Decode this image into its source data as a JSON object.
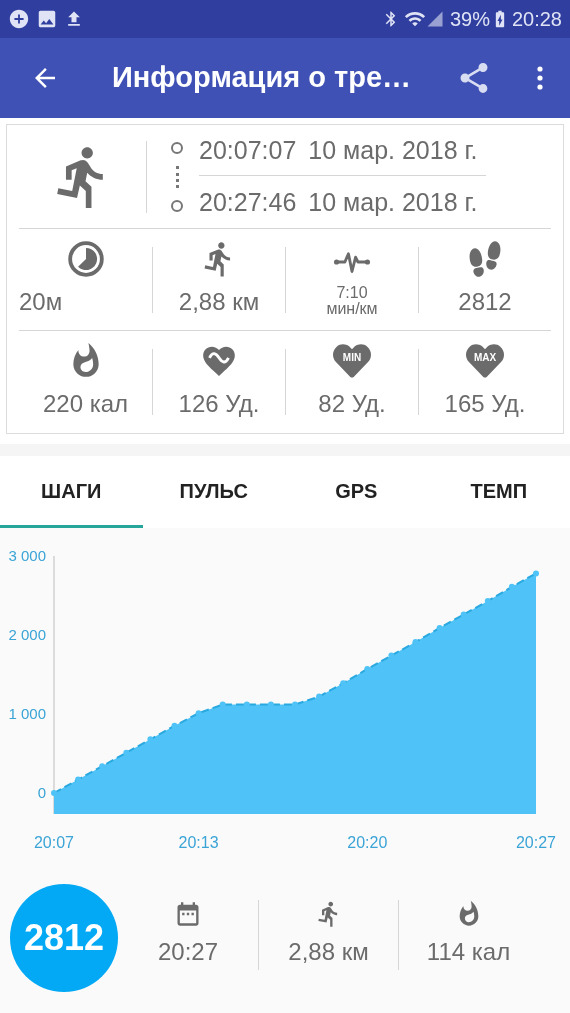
{
  "status_bar": {
    "battery": "39%",
    "time": "20:28"
  },
  "app_bar": {
    "title": "Информация о тре…"
  },
  "summary": {
    "start": {
      "time": "20:07:07",
      "date": "10 мар. 2018 г."
    },
    "end": {
      "time": "20:27:46",
      "date": "10 мар. 2018 г."
    },
    "rows": [
      [
        {
          "lines": [
            "20м"
          ]
        },
        {
          "lines": [
            "2,88 км"
          ]
        },
        {
          "lines": [
            "7:10",
            "мин/км"
          ]
        },
        {
          "lines": [
            "2812"
          ]
        }
      ],
      [
        {
          "lines": [
            "220 кал"
          ]
        },
        {
          "lines": [
            "126 Уд."
          ]
        },
        {
          "badge": "MIN",
          "lines": [
            "82 Уд."
          ]
        },
        {
          "badge": "MAX",
          "lines": [
            "165 Уд."
          ]
        }
      ]
    ]
  },
  "tabs": [
    {
      "label": "ШАГИ",
      "selected": true
    },
    {
      "label": "ПУЛЬС",
      "selected": false
    },
    {
      "label": "GPS",
      "selected": false
    },
    {
      "label": "ТЕМП",
      "selected": false
    }
  ],
  "chart": {
    "chart_data": {
      "type": "area",
      "categories": [
        "20:07",
        null,
        null,
        null,
        null,
        null,
        "20:13",
        null,
        null,
        null,
        null,
        null,
        null,
        "20:20",
        null,
        null,
        null,
        null,
        null,
        null,
        "20:27"
      ],
      "series": [
        {
          "color": "#4fc3f7",
          "values": [
            0,
            170,
            340,
            510,
            680,
            850,
            1010,
            1120,
            1120,
            1120,
            1120,
            1220,
            1390,
            1570,
            1740,
            1910,
            2090,
            2260,
            2430,
            2610,
            2780
          ]
        }
      ],
      "ylim": [
        0,
        3000
      ],
      "yticks": [
        {
          "value": 0,
          "label": "0"
        },
        {
          "value": 1000,
          "label": "1 000"
        },
        {
          "value": 2000,
          "label": "2 000"
        },
        {
          "value": 3000,
          "label": "3 000"
        }
      ]
    }
  },
  "footer": {
    "steps": "2812",
    "stats": [
      {
        "value": "20:27"
      },
      {
        "value": "2,88 км"
      },
      {
        "value": "114 кал"
      }
    ]
  }
}
